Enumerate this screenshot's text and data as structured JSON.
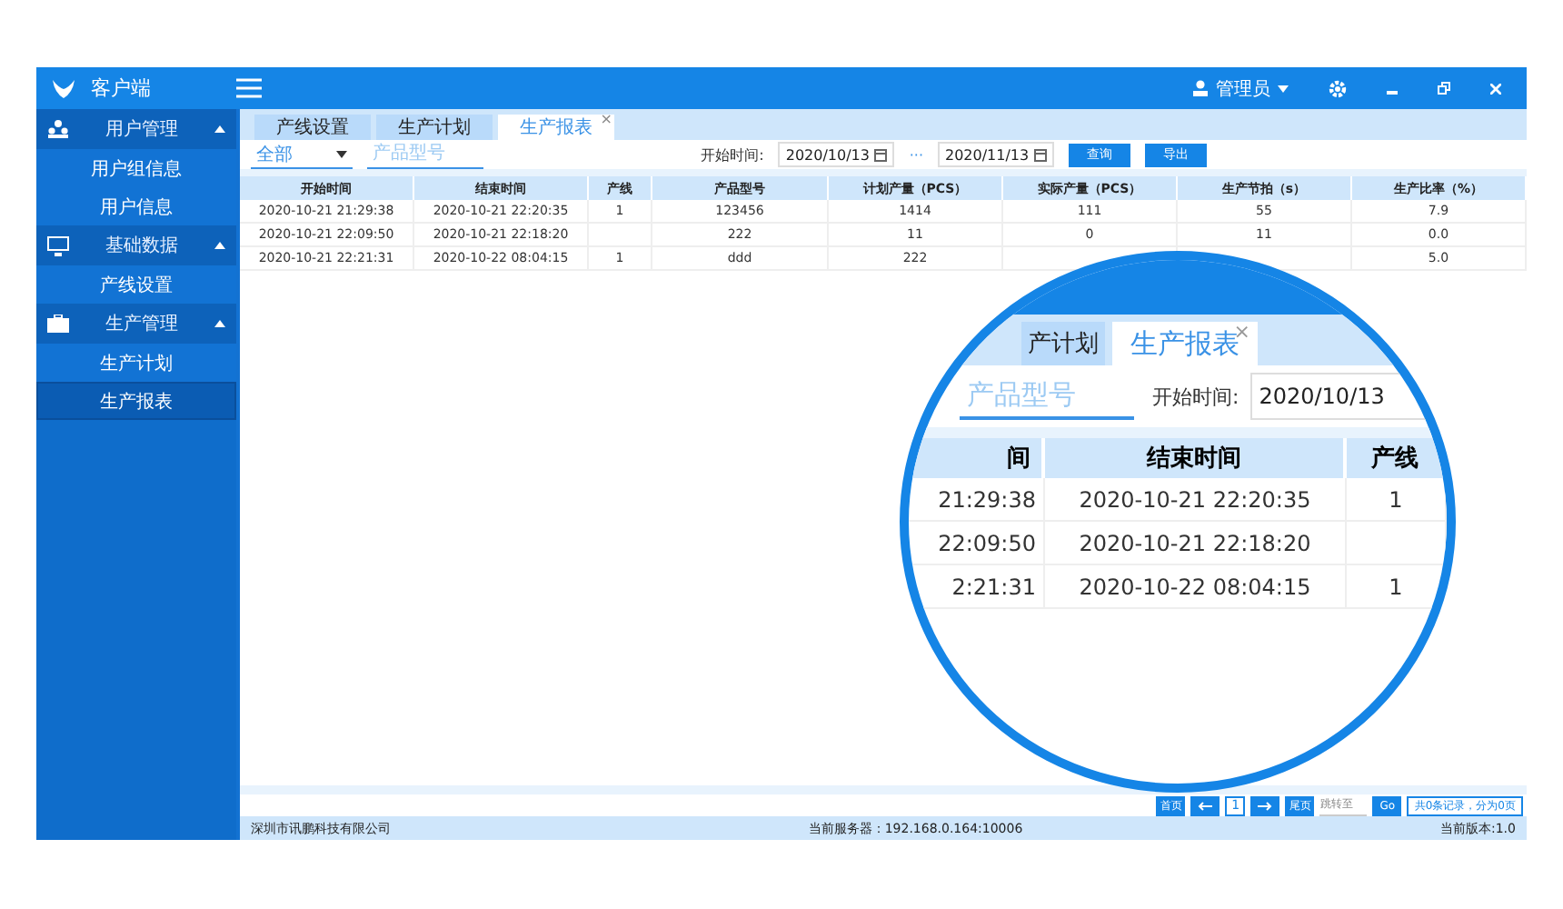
{
  "header": {
    "app_title": "客户端",
    "user": "管理员"
  },
  "sidebar": {
    "groups": [
      {
        "label": "用户管理",
        "kind": "users",
        "expanded": true,
        "children": [
          {
            "label": "用户组信息",
            "selected": false
          },
          {
            "label": "用户信息",
            "selected": false
          }
        ]
      },
      {
        "label": "基础数据",
        "kind": "monitor",
        "expanded": true,
        "children": [
          {
            "label": "产线设置",
            "selected": false
          }
        ]
      },
      {
        "label": "生产管理",
        "kind": "briefcase",
        "expanded": true,
        "children": [
          {
            "label": "生产计划",
            "selected": false
          },
          {
            "label": "生产报表",
            "selected": true
          }
        ]
      }
    ]
  },
  "tabs": [
    {
      "label": "产线设置",
      "selected": false
    },
    {
      "label": "生产计划",
      "selected": false
    },
    {
      "label": "生产报表",
      "selected": true,
      "close": "×"
    }
  ],
  "filter": {
    "select": "全部",
    "model_placeholder": "产品型号",
    "date_label": "开始时间:",
    "date_from": "2020/10/13",
    "separator": "···",
    "date_to": "2020/11/13",
    "buttons": [
      "查询",
      "导出"
    ]
  },
  "table": {
    "columns": [
      "开始时间",
      "结束时间",
      "产线",
      "产品型号",
      "计划产量（PCS）",
      "实际产量（PCS）",
      "生产节拍（s）",
      "生产比率（%）"
    ],
    "rows": [
      {
        "cells": [
          "2020-10-21 21:29:38",
          "2020-10-21 22:20:35",
          "1",
          "123456",
          "1414",
          "111",
          "55",
          "7.9"
        ]
      },
      {
        "cells": [
          "2020-10-21 22:09:50",
          "2020-10-21 22:18:20",
          null,
          "222",
          "11",
          "0",
          "11",
          "0.0"
        ]
      },
      {
        "cells": [
          "2020-10-21 22:21:31",
          "2020-10-22 08:04:15",
          "1",
          "ddd",
          "222",
          null,
          null,
          "5.0"
        ]
      }
    ]
  },
  "magnifier": {
    "tabs": [
      {
        "label": "产计划",
        "selected": false
      },
      {
        "label": "生产报表",
        "selected": true,
        "close": "×"
      }
    ],
    "model_placeholder": "产品型号",
    "date_label": "开始时间:",
    "date_from": "2020/10/13",
    "columns": [
      "间",
      "结束时间",
      "产线"
    ],
    "rows": [
      [
        "21:29:38",
        "2020-10-21 22:20:35",
        "1"
      ],
      [
        "22:09:50",
        "2020-10-21 22:18:20",
        null
      ],
      [
        "2:21:31",
        "2020-10-22 08:04:15",
        "1"
      ]
    ]
  },
  "pagination": {
    "first": "首页",
    "page": "1",
    "last": "尾页",
    "jump_placeholder": "跳转至",
    "go": "Go",
    "summary": "共0条记录，分为0页"
  },
  "status_bar": {
    "company": "深圳市讯鹏科技有限公司",
    "server": "当前服务器：192.168.0.164:10006",
    "version": "当前版本:1.0"
  }
}
